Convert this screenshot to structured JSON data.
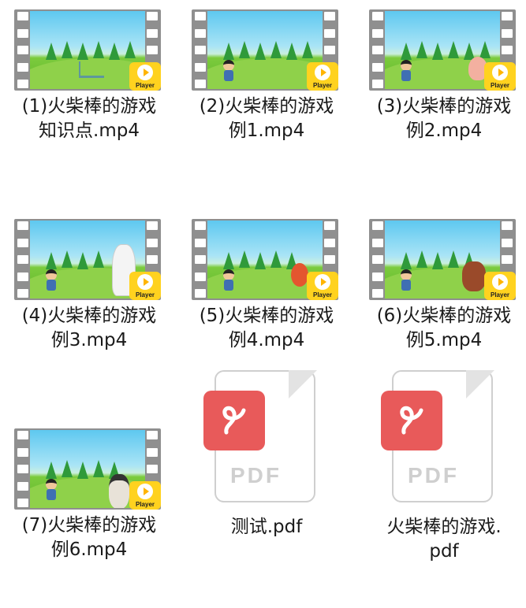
{
  "files": [
    {
      "type": "video",
      "name": "(1)火柴棒的游戏\n知识点.mp4",
      "badge": "Player",
      "scene": "title"
    },
    {
      "type": "video",
      "name": "(2)火柴棒的游戏\n例1.mp4",
      "badge": "Player",
      "scene": "girl"
    },
    {
      "type": "video",
      "name": "(3)火柴棒的游戏\n例2.mp4",
      "badge": "Player",
      "scene": "girl-pig"
    },
    {
      "type": "video",
      "name": "(4)火柴棒的游戏\n例3.mp4",
      "badge": "Player",
      "scene": "girl-horse"
    },
    {
      "type": "video",
      "name": "(5)火柴棒的游戏\n例4.mp4",
      "badge": "Player",
      "scene": "girl-rooster"
    },
    {
      "type": "video",
      "name": "(6)火柴棒的游戏\n例5.mp4",
      "badge": "Player",
      "scene": "girl-monkey"
    },
    {
      "type": "video",
      "name": "(7)火柴棒的游戏\n例6.mp4",
      "badge": "Player",
      "scene": "girl-man"
    },
    {
      "type": "pdf",
      "name": "测试.pdf",
      "badge": "PDF"
    },
    {
      "type": "pdf",
      "name": "火柴棒的游戏.\npdf",
      "badge": "PDF"
    }
  ],
  "colors": {
    "player_badge": "#ffd21f",
    "pdf_badge": "#e85a5a",
    "film": "#8f8f8f"
  },
  "icons": {
    "video": "video-file-icon",
    "pdf": "pdf-file-icon"
  }
}
